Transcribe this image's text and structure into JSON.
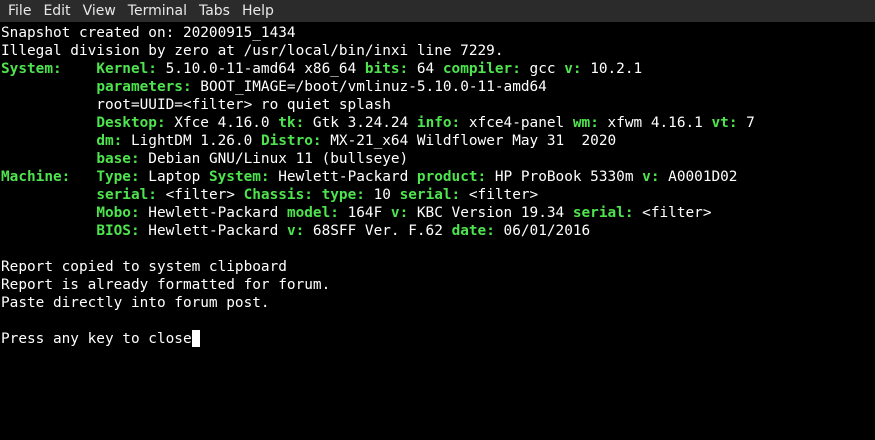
{
  "colors": {
    "background": "#000000",
    "menubar_bg": "#2b2b2b",
    "text": "#ffffff",
    "key": "#4ee44e"
  },
  "menubar": {
    "items": [
      "File",
      "Edit",
      "View",
      "Terminal",
      "Tabs",
      "Help"
    ]
  },
  "terminal": {
    "lines": [
      [
        {
          "t": "Snapshot created on: 20200915_1434"
        }
      ],
      [
        {
          "t": "Illegal division by zero at /usr/local/bin/inxi line 7229."
        }
      ],
      [
        {
          "t": "System:    ",
          "k": true
        },
        {
          "t": "Kernel:",
          "k": true
        },
        {
          "t": " 5.10.0-11-amd64 x86_64 "
        },
        {
          "t": "bits:",
          "k": true
        },
        {
          "t": " 64 "
        },
        {
          "t": "compiler:",
          "k": true
        },
        {
          "t": " gcc "
        },
        {
          "t": "v:",
          "k": true
        },
        {
          "t": " 10.2.1"
        }
      ],
      [
        {
          "t": "           "
        },
        {
          "t": "parameters:",
          "k": true
        },
        {
          "t": " BOOT_IMAGE=/boot/vmlinuz-5.10.0-11-amd64"
        }
      ],
      [
        {
          "t": "           root=UUID=<filter> ro quiet splash"
        }
      ],
      [
        {
          "t": "           "
        },
        {
          "t": "Desktop:",
          "k": true
        },
        {
          "t": " Xfce 4.16.0 "
        },
        {
          "t": "tk:",
          "k": true
        },
        {
          "t": " Gtk 3.24.24 "
        },
        {
          "t": "info:",
          "k": true
        },
        {
          "t": " xfce4-panel "
        },
        {
          "t": "wm:",
          "k": true
        },
        {
          "t": " xfwm 4.16.1 "
        },
        {
          "t": "vt:",
          "k": true
        },
        {
          "t": " 7"
        }
      ],
      [
        {
          "t": "           "
        },
        {
          "t": "dm:",
          "k": true
        },
        {
          "t": " LightDM 1.26.0 "
        },
        {
          "t": "Distro:",
          "k": true
        },
        {
          "t": " MX-21_x64 Wildflower May 31  2020"
        }
      ],
      [
        {
          "t": "           "
        },
        {
          "t": "base:",
          "k": true
        },
        {
          "t": " Debian GNU/Linux 11 (bullseye)"
        }
      ],
      [
        {
          "t": "Machine:   ",
          "k": true
        },
        {
          "t": "Type:",
          "k": true
        },
        {
          "t": " Laptop "
        },
        {
          "t": "System:",
          "k": true
        },
        {
          "t": " Hewlett-Packard "
        },
        {
          "t": "product:",
          "k": true
        },
        {
          "t": " HP ProBook 5330m "
        },
        {
          "t": "v:",
          "k": true
        },
        {
          "t": " A0001D02"
        }
      ],
      [
        {
          "t": "           "
        },
        {
          "t": "serial:",
          "k": true
        },
        {
          "t": " <filter> "
        },
        {
          "t": "Chassis:",
          "k": true
        },
        {
          "t": " "
        },
        {
          "t": "type:",
          "k": true
        },
        {
          "t": " 10 "
        },
        {
          "t": "serial:",
          "k": true
        },
        {
          "t": " <filter>"
        }
      ],
      [
        {
          "t": "           "
        },
        {
          "t": "Mobo:",
          "k": true
        },
        {
          "t": " Hewlett-Packard "
        },
        {
          "t": "model:",
          "k": true
        },
        {
          "t": " 164F "
        },
        {
          "t": "v:",
          "k": true
        },
        {
          "t": " KBC Version 19.34 "
        },
        {
          "t": "serial:",
          "k": true
        },
        {
          "t": " <filter>"
        }
      ],
      [
        {
          "t": "           "
        },
        {
          "t": "BIOS:",
          "k": true
        },
        {
          "t": " Hewlett-Packard "
        },
        {
          "t": "v:",
          "k": true
        },
        {
          "t": " 68SFF Ver. F.62 "
        },
        {
          "t": "date:",
          "k": true
        },
        {
          "t": " 06/01/2016"
        }
      ],
      [],
      [
        {
          "t": "Report copied to system clipboard"
        }
      ],
      [
        {
          "t": "Report is already formatted for forum."
        }
      ],
      [
        {
          "t": "Paste directly into forum post."
        }
      ],
      [],
      [
        {
          "t": "Press any key to close"
        },
        {
          "cursor": true
        }
      ]
    ]
  }
}
